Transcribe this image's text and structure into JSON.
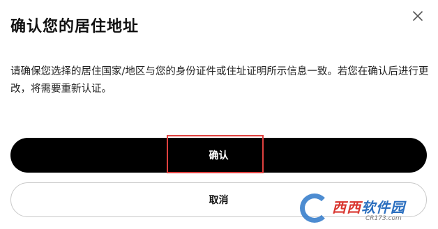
{
  "dialog": {
    "title": "确认您的居住地址",
    "description": "请确保您选择的居住国家/地区与您的身份证件或住址证明所示信息一致。若您在确认后进行更改，将需要重新认证。",
    "confirm_label": "确认",
    "cancel_label": "取消",
    "close_icon": "close-icon"
  },
  "watermark": {
    "brand_red": "西西",
    "brand_blue": "软件园",
    "site": "CR173.com"
  },
  "colors": {
    "primary_button": "#000000",
    "highlight": "#e0413f",
    "watermark_blue": "#2f79c9",
    "watermark_red": "#d9362f"
  }
}
